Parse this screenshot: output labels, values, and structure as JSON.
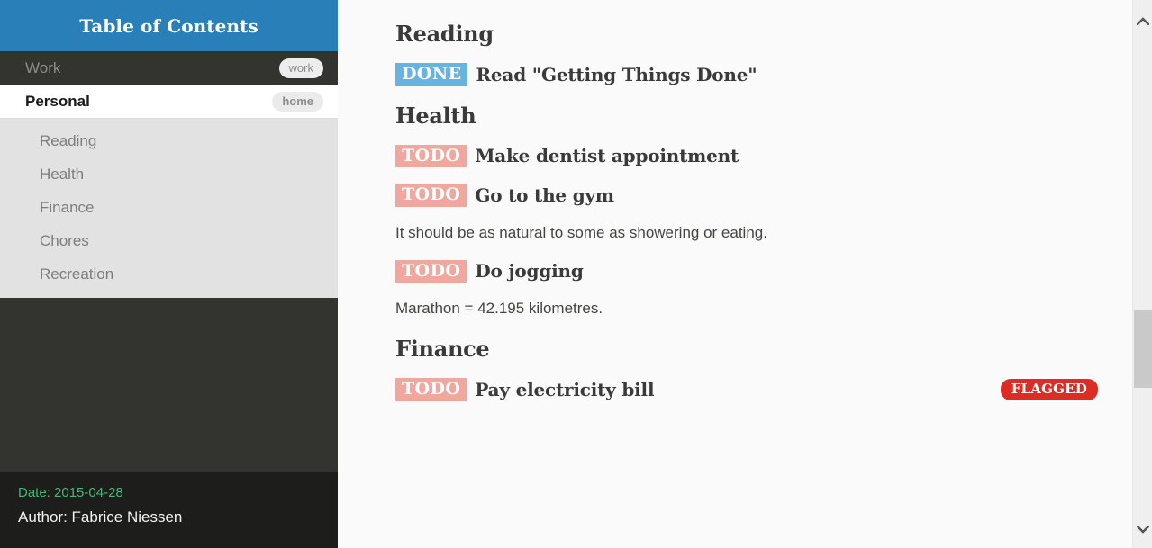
{
  "sidebar": {
    "header_title": "Table of Contents",
    "top_items": [
      {
        "label": "Work",
        "tag": "work",
        "state": "inactive"
      },
      {
        "label": "Personal",
        "tag": "home",
        "state": "active"
      }
    ],
    "sub_items": [
      {
        "label": "Reading"
      },
      {
        "label": "Health"
      },
      {
        "label": "Finance"
      },
      {
        "label": "Chores"
      },
      {
        "label": "Recreation"
      }
    ],
    "footer": {
      "date": "Date: 2015-04-28",
      "author": "Author: Fabrice Niessen"
    }
  },
  "content": {
    "sections": [
      {
        "heading": "Reading",
        "items": [
          {
            "kind": "task",
            "keyword": "DONE",
            "title": "Read \"Getting Things Done\"",
            "flag": null
          }
        ]
      },
      {
        "heading": "Health",
        "items": [
          {
            "kind": "task",
            "keyword": "TODO",
            "title": "Make dentist appointment",
            "flag": null
          },
          {
            "kind": "task",
            "keyword": "TODO",
            "title": "Go to the gym",
            "flag": null
          },
          {
            "kind": "para",
            "text": "It should be as natural to some as showering or eating."
          },
          {
            "kind": "task",
            "keyword": "TODO",
            "title": "Do jogging",
            "flag": null
          },
          {
            "kind": "para",
            "text": "Marathon = 42.195 kilometres."
          }
        ]
      },
      {
        "heading": "Finance",
        "items": [
          {
            "kind": "task",
            "keyword": "TODO",
            "title": "Pay electricity bill",
            "flag": "FLAGGED"
          }
        ]
      }
    ]
  },
  "scrollbar": {
    "up_icon": "chevron-up-icon",
    "down_icon": "chevron-down-icon"
  },
  "colors": {
    "header_blue": "#2980b9",
    "sidebar_dark": "#333330",
    "sidebar_footer_dark": "#1d1d1b",
    "sub_list_gray": "#e2e2e2",
    "done_badge": "#68b3e0",
    "todo_badge": "#f0a79d",
    "flag_badge": "#dd2c23",
    "date_green": "#49b675",
    "content_bg": "#fafafa"
  }
}
